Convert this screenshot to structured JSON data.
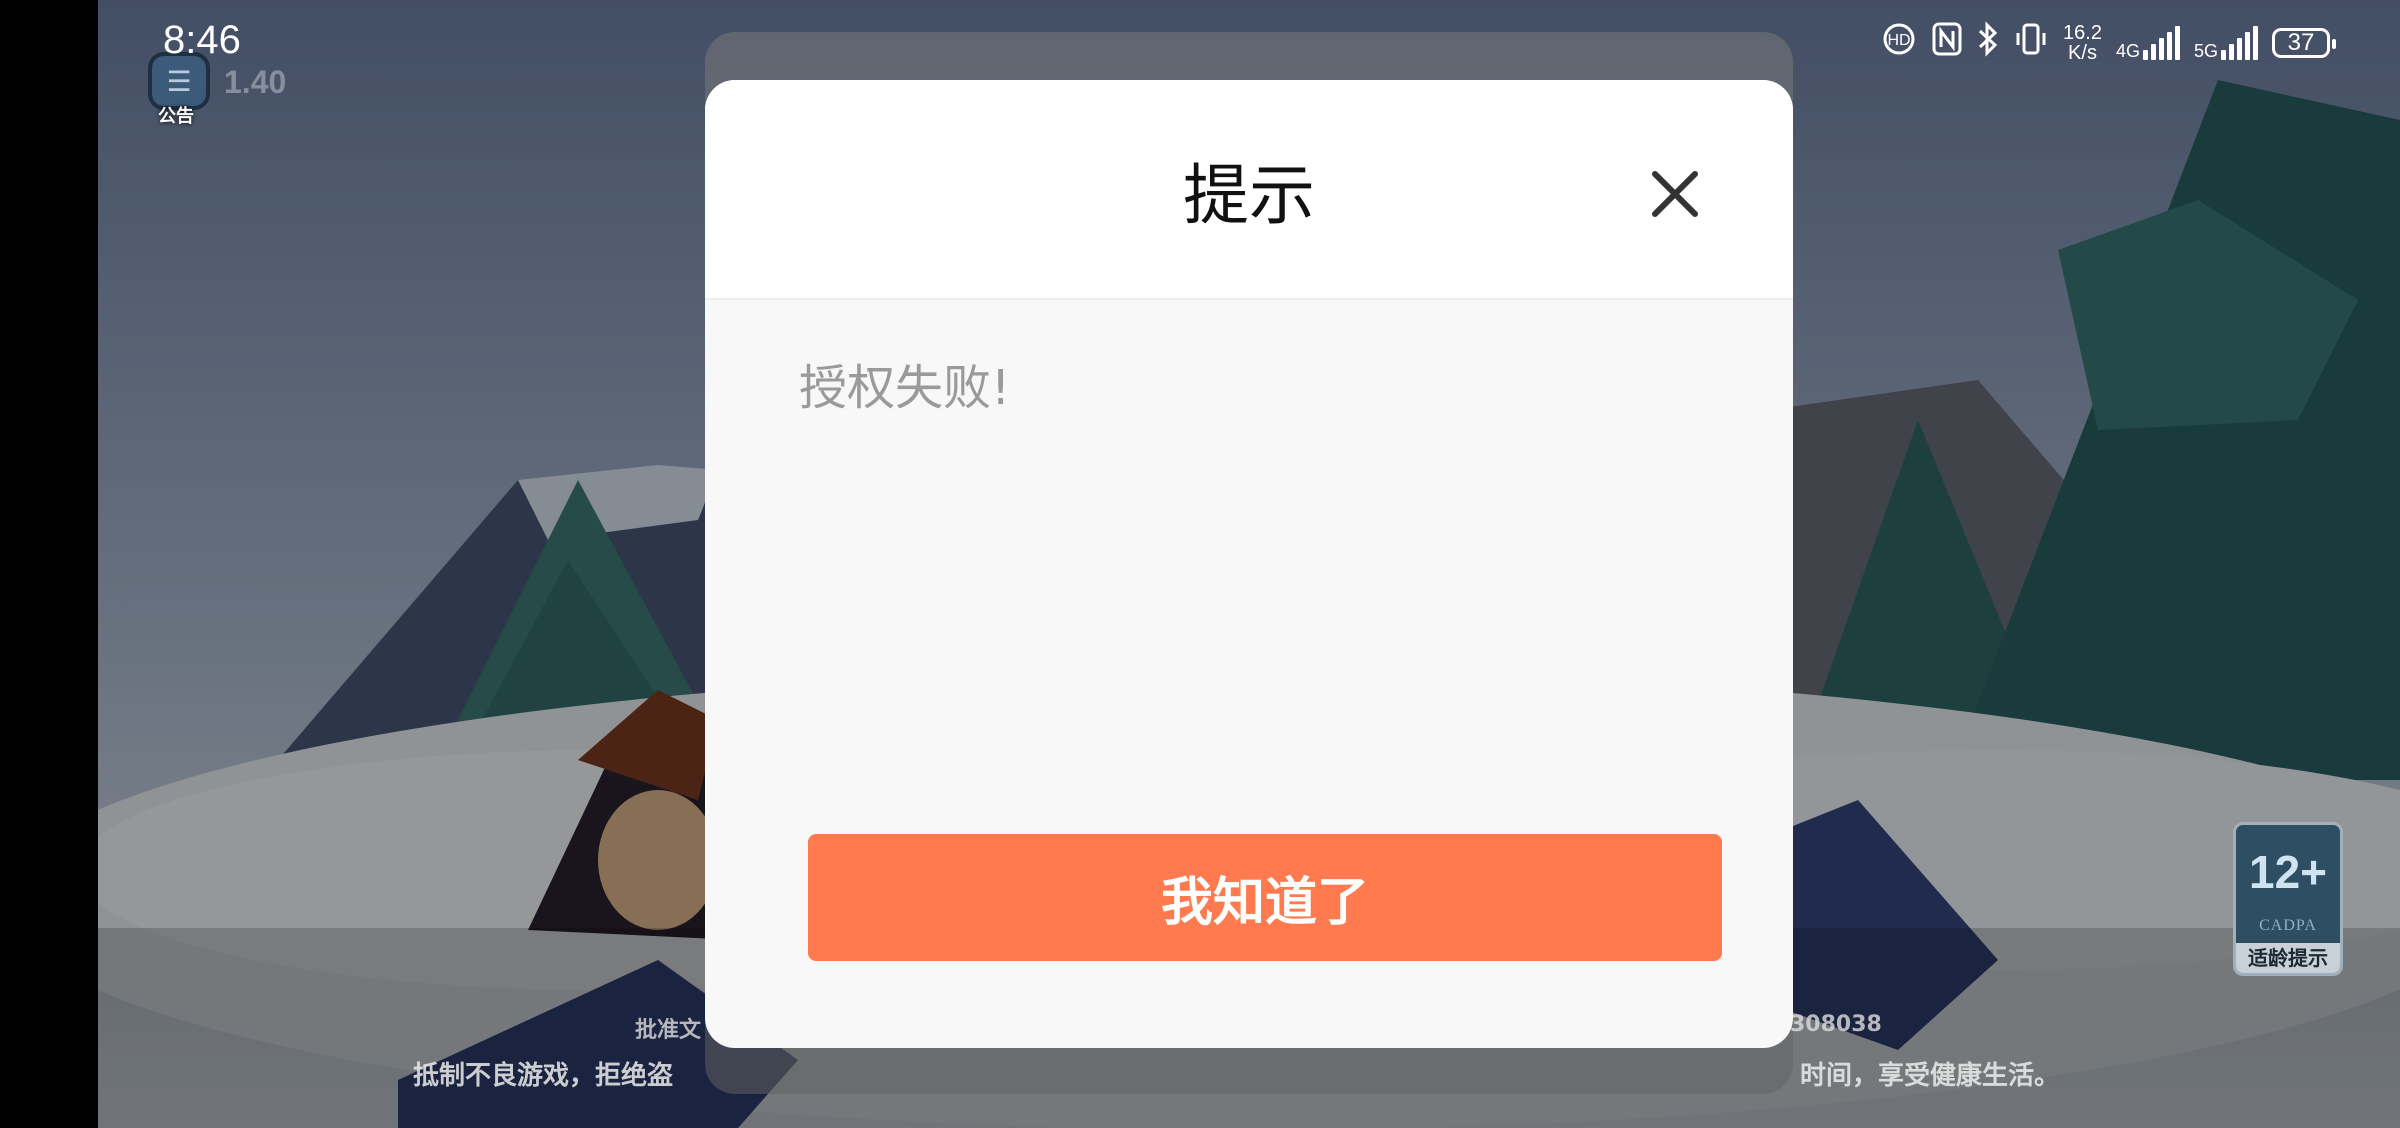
{
  "status_bar": {
    "time": "8:46",
    "net_speed_value": "16.2",
    "net_speed_unit": "K/s",
    "network_1": "4G",
    "network_2": "5G",
    "battery_level": "37",
    "icons": [
      "hd-icon",
      "nfc-icon",
      "bluetooth-icon",
      "vibrate-icon",
      "signal-icon",
      "battery-icon"
    ]
  },
  "game": {
    "notice_label": "公告",
    "version": "1.40",
    "approval_text": "批准文",
    "approval_suffix": "308038",
    "health_left": "抵制不良游戏，拒绝盗",
    "health_right": "时间，享受健康生活。",
    "age_rating": {
      "number": "12+",
      "org": "CADPA",
      "label": "适龄提示"
    }
  },
  "dialog": {
    "title": "提示",
    "message": "授权失败!",
    "confirm_label": "我知道了",
    "accent_color": "#ff7a4e"
  }
}
